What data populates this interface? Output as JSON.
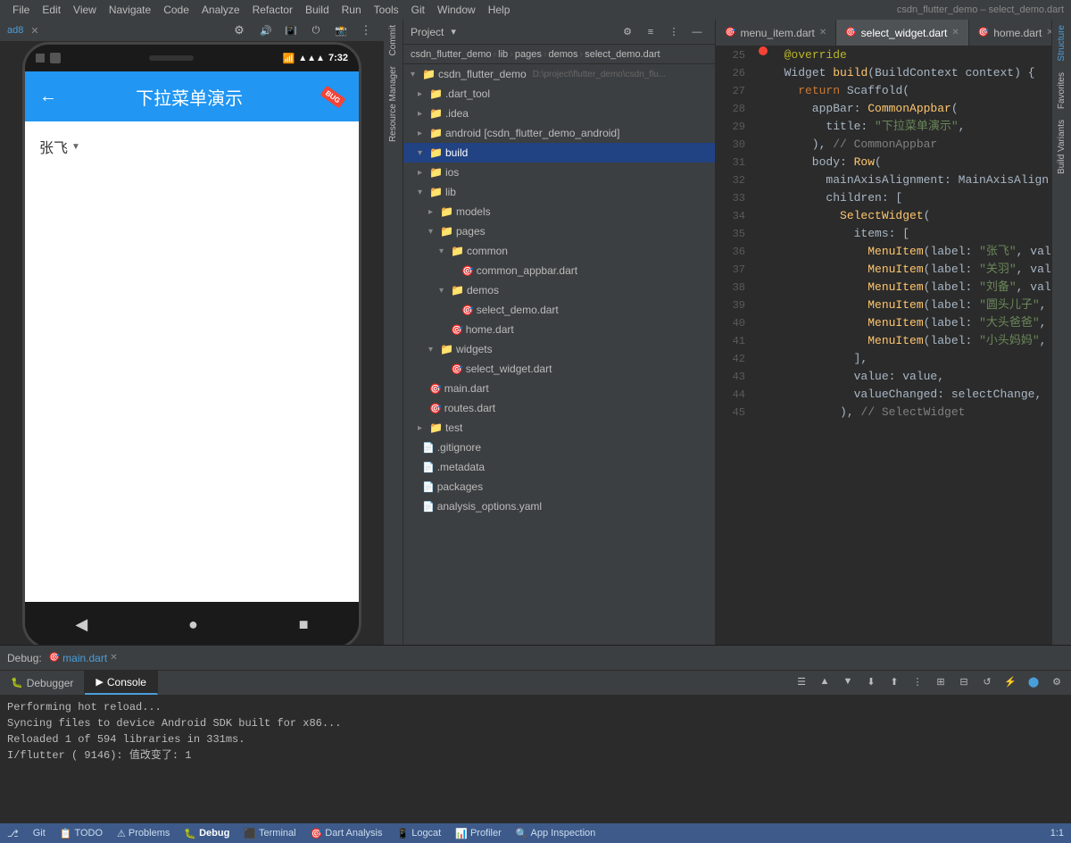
{
  "window": {
    "title": "csdn_flutter_demo – select_demo.dart",
    "emulator_label": "ad8"
  },
  "menu": {
    "items": [
      "File",
      "Edit",
      "View",
      "Navigate",
      "Code",
      "Analyze",
      "Refactor",
      "Build",
      "Run",
      "Tools",
      "Git",
      "Window",
      "Help"
    ]
  },
  "breadcrumb": {
    "items": [
      "csdn_flutter_demo",
      "lib",
      "pages",
      "demos",
      "select_demo.dart"
    ]
  },
  "tabs": [
    {
      "label": "menu_item.dart",
      "closable": true
    },
    {
      "label": "select_widget.dart",
      "closable": true,
      "active": true
    },
    {
      "label": "home.dart",
      "closable": true
    }
  ],
  "project": {
    "header": "Project",
    "tree": [
      {
        "label": "csdn_flutter_demo",
        "indent": 0,
        "type": "root",
        "expanded": true
      },
      {
        "label": ".dart_tool",
        "indent": 1,
        "type": "folder",
        "expanded": false
      },
      {
        "label": ".idea",
        "indent": 1,
        "type": "folder",
        "expanded": false
      },
      {
        "label": "android [csdn_flutter_demo_android]",
        "indent": 1,
        "type": "folder",
        "expanded": false
      },
      {
        "label": "build",
        "indent": 1,
        "type": "folder",
        "expanded": true,
        "selected": true
      },
      {
        "label": "ios",
        "indent": 1,
        "type": "folder",
        "expanded": false
      },
      {
        "label": "lib",
        "indent": 1,
        "type": "folder",
        "expanded": true
      },
      {
        "label": "models",
        "indent": 2,
        "type": "folder",
        "expanded": false
      },
      {
        "label": "pages",
        "indent": 2,
        "type": "folder",
        "expanded": true
      },
      {
        "label": "common",
        "indent": 3,
        "type": "folder",
        "expanded": true
      },
      {
        "label": "common_appbar.dart",
        "indent": 4,
        "type": "dart"
      },
      {
        "label": "demos",
        "indent": 3,
        "type": "folder",
        "expanded": true
      },
      {
        "label": "select_demo.dart",
        "indent": 4,
        "type": "dart"
      },
      {
        "label": "home.dart",
        "indent": 3,
        "type": "dart"
      },
      {
        "label": "widgets",
        "indent": 2,
        "type": "folder",
        "expanded": true
      },
      {
        "label": "select_widget.dart",
        "indent": 3,
        "type": "dart"
      },
      {
        "label": "main.dart",
        "indent": 1,
        "type": "dart"
      },
      {
        "label": "routes.dart",
        "indent": 1,
        "type": "dart"
      },
      {
        "label": "test",
        "indent": 1,
        "type": "folder",
        "expanded": false
      },
      {
        "label": ".gitignore",
        "indent": 0,
        "type": "file"
      },
      {
        "label": ".metadata",
        "indent": 0,
        "type": "file"
      },
      {
        "label": "packages",
        "indent": 0,
        "type": "file"
      },
      {
        "label": "analysis_options.yaml",
        "indent": 0,
        "type": "file"
      }
    ]
  },
  "code": {
    "lines": [
      {
        "num": 25,
        "breakpoint": true,
        "content": "  @override",
        "tokens": [
          {
            "text": "  ",
            "class": ""
          },
          {
            "text": "@override",
            "class": "ann"
          }
        ]
      },
      {
        "num": 26,
        "content": "  Widget build(BuildContext context) {",
        "tokens": [
          {
            "text": "  ",
            "class": ""
          },
          {
            "text": "Widget",
            "class": "cls"
          },
          {
            "text": " ",
            "class": ""
          },
          {
            "text": "build",
            "class": "fn"
          },
          {
            "text": "(",
            "class": ""
          },
          {
            "text": "BuildContext",
            "class": "cls"
          },
          {
            "text": " context) {",
            "class": ""
          }
        ]
      },
      {
        "num": 27,
        "content": "    return Scaffold(",
        "tokens": [
          {
            "text": "    ",
            "class": ""
          },
          {
            "text": "return",
            "class": "kw"
          },
          {
            "text": " Scaffold(",
            "class": ""
          }
        ]
      },
      {
        "num": 28,
        "content": "      appBar: CommonAppbar(",
        "tokens": [
          {
            "text": "      appBar: ",
            "class": ""
          },
          {
            "text": "CommonAppbar",
            "class": "fn"
          },
          {
            "text": "(",
            "class": ""
          }
        ]
      },
      {
        "num": 29,
        "content": "        title: \"下拉菜单演示\",",
        "tokens": [
          {
            "text": "        title: ",
            "class": ""
          },
          {
            "text": "\"下拉菜单演示\"",
            "class": "str"
          },
          {
            "text": ",",
            "class": ""
          }
        ]
      },
      {
        "num": 30,
        "content": "      ), // CommonAppbar",
        "tokens": [
          {
            "text": "      ), ",
            "class": ""
          },
          {
            "text": "// CommonAppbar",
            "class": "comment"
          }
        ]
      },
      {
        "num": 31,
        "content": "      body: Row(",
        "tokens": [
          {
            "text": "      body: ",
            "class": ""
          },
          {
            "text": "Row",
            "class": "fn"
          },
          {
            "text": "(",
            "class": ""
          }
        ]
      },
      {
        "num": 32,
        "content": "        mainAxisAlignment: MainAxisAlign...",
        "tokens": [
          {
            "text": "        mainAxisAlignment: ",
            "class": ""
          },
          {
            "text": "MainAxisAlign...",
            "class": "cls"
          }
        ]
      },
      {
        "num": 33,
        "content": "        children: [",
        "tokens": [
          {
            "text": "        children: [",
            "class": ""
          }
        ]
      },
      {
        "num": 34,
        "content": "          SelectWidget(",
        "tokens": [
          {
            "text": "          ",
            "class": ""
          },
          {
            "text": "SelectWidget",
            "class": "fn"
          },
          {
            "text": "(",
            "class": ""
          }
        ]
      },
      {
        "num": 35,
        "content": "            items: [",
        "tokens": [
          {
            "text": "            items: [",
            "class": ""
          }
        ]
      },
      {
        "num": 36,
        "content": "              MenuItem(label: \"张飞\", val...",
        "tokens": [
          {
            "text": "              ",
            "class": ""
          },
          {
            "text": "MenuItem",
            "class": "fn"
          },
          {
            "text": "(label: ",
            "class": ""
          },
          {
            "text": "\"张飞\"",
            "class": "str"
          },
          {
            "text": ", val...",
            "class": ""
          }
        ]
      },
      {
        "num": 37,
        "content": "              MenuItem(label: \"关羽\", val...",
        "tokens": [
          {
            "text": "              ",
            "class": ""
          },
          {
            "text": "MenuItem",
            "class": "fn"
          },
          {
            "text": "(label: ",
            "class": ""
          },
          {
            "text": "\"关羽\"",
            "class": "str"
          },
          {
            "text": ", val...",
            "class": ""
          }
        ]
      },
      {
        "num": 38,
        "content": "              MenuItem(label: \"刘备\", val...",
        "tokens": [
          {
            "text": "              ",
            "class": ""
          },
          {
            "text": "MenuItem",
            "class": "fn"
          },
          {
            "text": "(label: ",
            "class": ""
          },
          {
            "text": "\"刘备\"",
            "class": "str"
          },
          {
            "text": ", val...",
            "class": ""
          }
        ]
      },
      {
        "num": 39,
        "content": "              MenuItem(label: \"圆头儿子\",",
        "tokens": [
          {
            "text": "              ",
            "class": ""
          },
          {
            "text": "MenuItem",
            "class": "fn"
          },
          {
            "text": "(label: ",
            "class": ""
          },
          {
            "text": "\"圆头儿子\"",
            "class": "str"
          },
          {
            "text": ",",
            "class": ""
          }
        ]
      },
      {
        "num": 40,
        "content": "              MenuItem(label: \"大头爸爸\",",
        "tokens": [
          {
            "text": "              ",
            "class": ""
          },
          {
            "text": "MenuItem",
            "class": "fn"
          },
          {
            "text": "(label: ",
            "class": ""
          },
          {
            "text": "\"大头爸爸\"",
            "class": "str"
          },
          {
            "text": ",",
            "class": ""
          }
        ]
      },
      {
        "num": 41,
        "content": "              MenuItem(label: \"小头妈妈\",",
        "tokens": [
          {
            "text": "              ",
            "class": ""
          },
          {
            "text": "MenuItem",
            "class": "fn"
          },
          {
            "text": "(label: ",
            "class": ""
          },
          {
            "text": "\"小头妈妈\"",
            "class": "str"
          },
          {
            "text": ",",
            "class": ""
          }
        ]
      },
      {
        "num": 42,
        "content": "            ],",
        "tokens": [
          {
            "text": "            ],",
            "class": ""
          }
        ]
      },
      {
        "num": 43,
        "content": "            value: value,",
        "tokens": [
          {
            "text": "            value: value,",
            "class": ""
          }
        ]
      },
      {
        "num": 44,
        "content": "            valueChanged: selectChange,",
        "tokens": [
          {
            "text": "            valueChanged: selectChange,",
            "class": ""
          }
        ]
      },
      {
        "num": 45,
        "content": "          ), // SelectWidget",
        "tokens": [
          {
            "text": "          ), ",
            "class": ""
          },
          {
            "text": "// SelectWidget",
            "class": "comment"
          }
        ]
      }
    ]
  },
  "debug": {
    "tab_label": "Debug:",
    "file_label": "main.dart",
    "bottom_tabs": [
      "Debugger",
      "Console"
    ],
    "active_bottom_tab": "Console",
    "console_lines": [
      "Performing hot reload...",
      "Syncing files to device Android SDK built for x86...",
      "Reloaded 1 of 594 libraries in 331ms.",
      "I/flutter ( 9146): 值改变了: 1"
    ]
  },
  "phone": {
    "time": "7:32",
    "title": "下拉菜单演示",
    "selected_value": "张飞",
    "dropdown_arrow": "▼"
  },
  "status_bar": {
    "items": [
      "Git",
      "TODO",
      "Problems",
      "Debug",
      "Terminal",
      "Dart Analysis",
      "Logcat",
      "Profiler",
      "App Inspection"
    ],
    "active": "Debug",
    "line_col": "1:1"
  },
  "side_panels": {
    "left": [
      "Commit",
      "Resource Manager"
    ],
    "right": [
      "Structure",
      "Favorites",
      "Build Variants"
    ]
  }
}
